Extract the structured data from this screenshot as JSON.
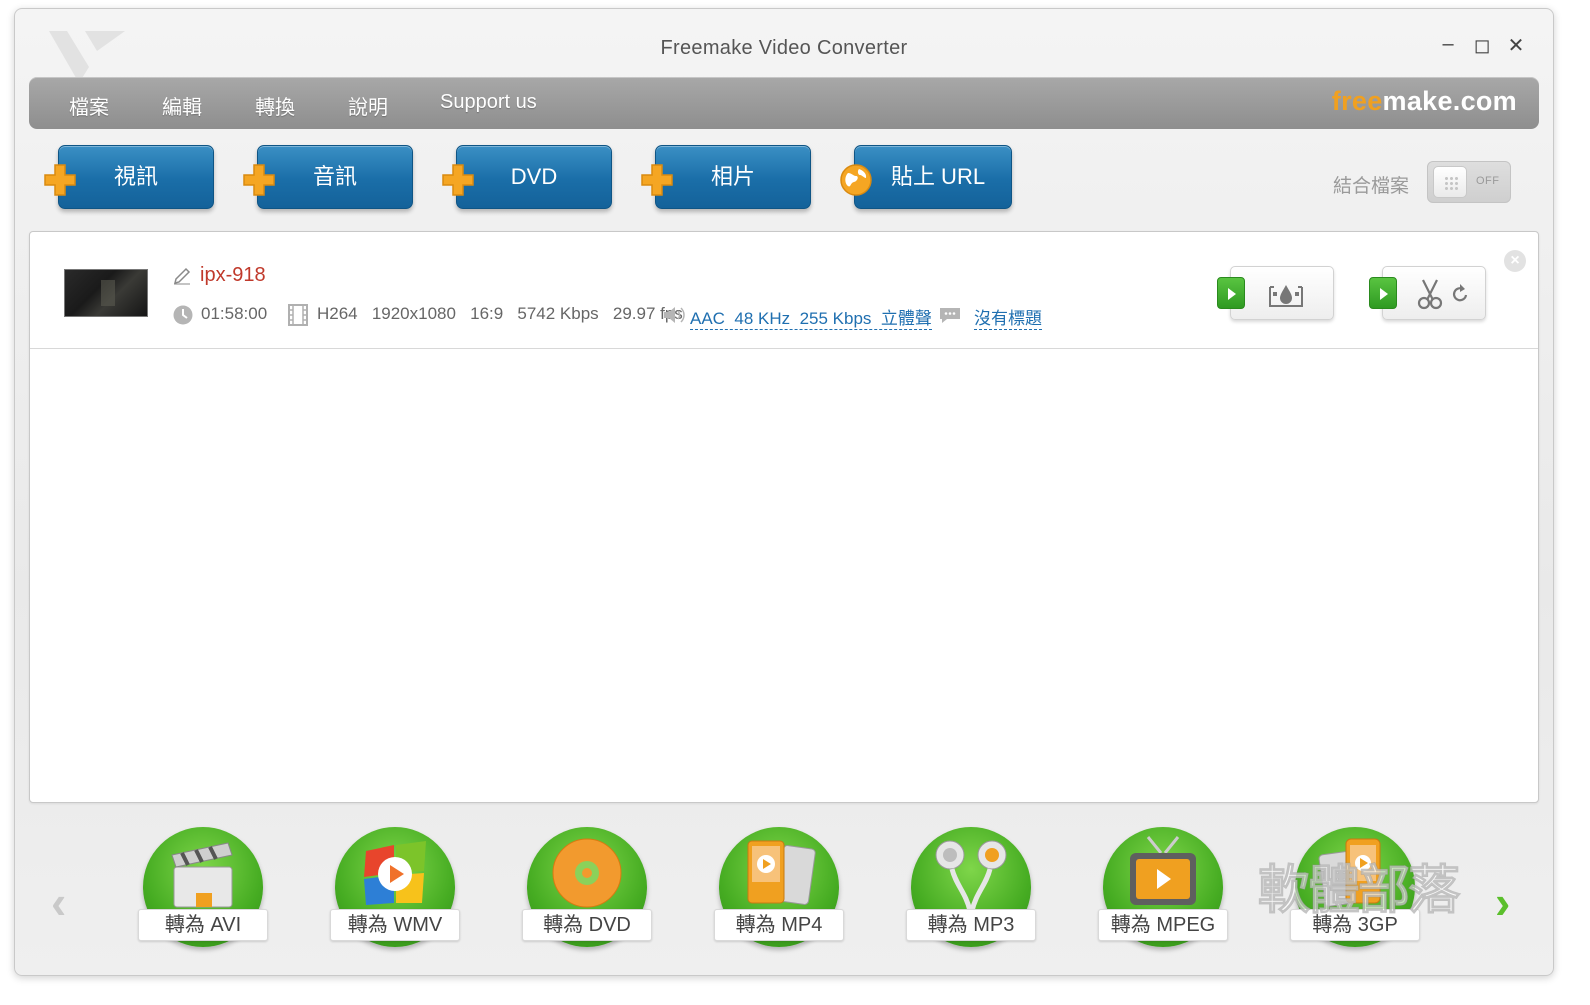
{
  "window": {
    "title": "Freemake Video Converter",
    "minimize": "–",
    "maximize": "◻",
    "close": "✕"
  },
  "menu": {
    "items": [
      "檔案",
      "編輯",
      "轉換",
      "說明",
      "Support us"
    ],
    "brand_free": "free",
    "brand_rest": "make.com"
  },
  "toolbar": {
    "buttons": [
      "視訊",
      "音訊",
      "DVD",
      "相片",
      "貼上 URL"
    ],
    "combine_label": "結合檔案",
    "toggle_state": "OFF"
  },
  "file": {
    "name": "ipx-918",
    "duration": "01:58:00",
    "video_codec": "H264",
    "resolution": "1920x1080",
    "aspect": "16:9",
    "bitrate": "5742 Kbps",
    "fps": "29.97 fps",
    "audio": "AAC  48 KHz  255 Kbps  立體聲",
    "subtitle": "沒有標題"
  },
  "converters": [
    "轉為 AVI",
    "轉為 WMV",
    "轉為 DVD",
    "轉為 MP4",
    "轉為 MP3",
    "轉為 MPEG",
    "轉為 3GP"
  ],
  "watermark": "軟體部落",
  "colors": {
    "accent_blue": "#1a6ea8",
    "green": "#46ac22",
    "file_name": "#c0392b",
    "link": "#1f6fb0",
    "orange": "#f0a020"
  }
}
